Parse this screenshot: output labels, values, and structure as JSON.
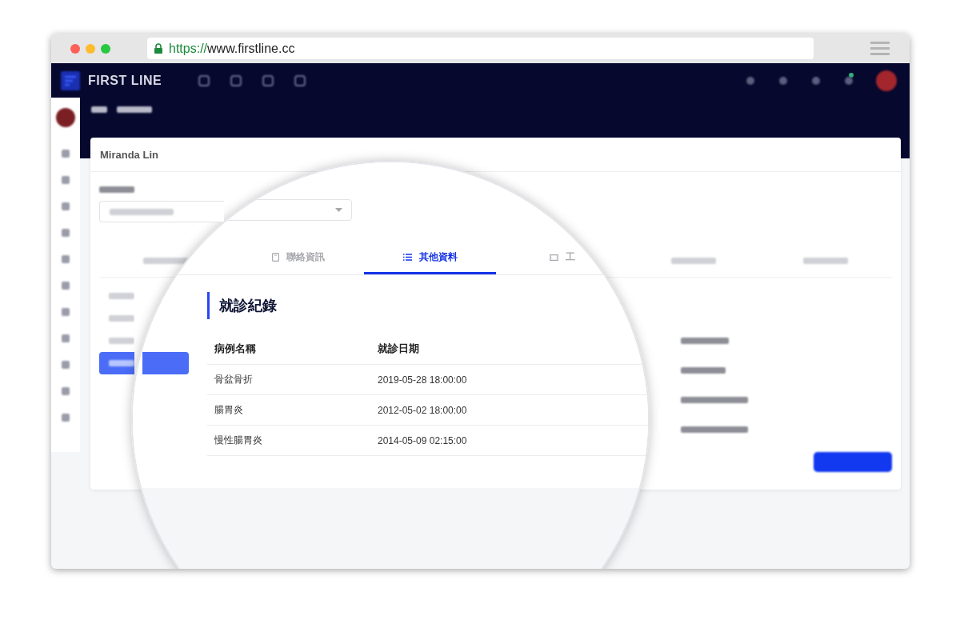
{
  "browser": {
    "url_scheme": "https://",
    "url_host": "www.firstline.cc"
  },
  "app": {
    "brand": "FIRST LINE",
    "patient_name": "Miranda Lin"
  },
  "side_menu": [
    {
      "selected": false
    },
    {
      "selected": false
    },
    {
      "selected": false
    },
    {
      "selected": true
    }
  ],
  "magnifier": {
    "tabs": [
      {
        "label": "聯絡資訊",
        "selected": false
      },
      {
        "label": "其他資料",
        "selected": true
      },
      {
        "label": "工",
        "selected": false
      }
    ],
    "section_title": "就診紀錄",
    "table": {
      "columns": [
        "病例名稱",
        "就診日期"
      ],
      "rows": [
        [
          "骨盆骨折",
          "2019-05-28 18:00:00"
        ],
        [
          "腸胃炎",
          "2012-05-02 18:00:00"
        ],
        [
          "慢性腸胃炎",
          "2014-05-09 02:15:00"
        ]
      ]
    }
  }
}
